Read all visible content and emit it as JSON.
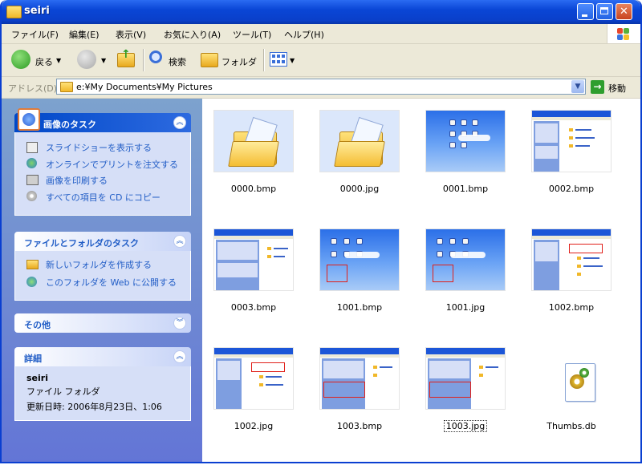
{
  "window": {
    "title": "seiri",
    "buttons": {
      "minimize": "",
      "maximize": "",
      "close": "✕"
    }
  },
  "menu": [
    "ファイル(F)",
    "編集(E)",
    "表示(V)",
    "お気に入り(A)",
    "ツール(T)",
    "ヘルプ(H)"
  ],
  "toolbar": {
    "back_label": "戻る",
    "search_label": "検索",
    "folder_label": "フォルダ"
  },
  "address": {
    "label": "アドレス(D)",
    "value": "e:¥My Documents¥My Pictures",
    "go_label": "移動"
  },
  "panels": {
    "image_tasks": {
      "title": "画像のタスク",
      "links": [
        "スライドショーを表示する",
        "オンラインでプリントを注文する",
        "画像を印刷する",
        "すべての項目を CD にコピー"
      ]
    },
    "file_folder_tasks": {
      "title": "ファイルとフォルダのタスク",
      "links": [
        "新しいフォルダを作成する",
        "このフォルダを Web に公開する"
      ]
    },
    "other": {
      "title": "その他"
    },
    "details": {
      "title": "詳細",
      "name": "seiri",
      "type": "ファイル フォルダ",
      "modified": "更新日時: 2006年8月23日、1:06"
    }
  },
  "files": [
    {
      "name": "0000.bmp",
      "kind": "folder"
    },
    {
      "name": "0000.jpg",
      "kind": "folder"
    },
    {
      "name": "0001.bmp",
      "kind": "desktop"
    },
    {
      "name": "0002.bmp",
      "kind": "explorer"
    },
    {
      "name": "0003.bmp",
      "kind": "explorer"
    },
    {
      "name": "1001.bmp",
      "kind": "desktop"
    },
    {
      "name": "1001.jpg",
      "kind": "desktop"
    },
    {
      "name": "1002.bmp",
      "kind": "explorer"
    },
    {
      "name": "1002.jpg",
      "kind": "explorer"
    },
    {
      "name": "1003.bmp",
      "kind": "explorer"
    },
    {
      "name": "1003.jpg",
      "kind": "explorer",
      "selected": true
    },
    {
      "name": "Thumbs.db",
      "kind": "db"
    }
  ],
  "colors": {
    "titlebar": "#0a46d6",
    "panel": "#6f8cd6",
    "link": "#215dc6"
  }
}
